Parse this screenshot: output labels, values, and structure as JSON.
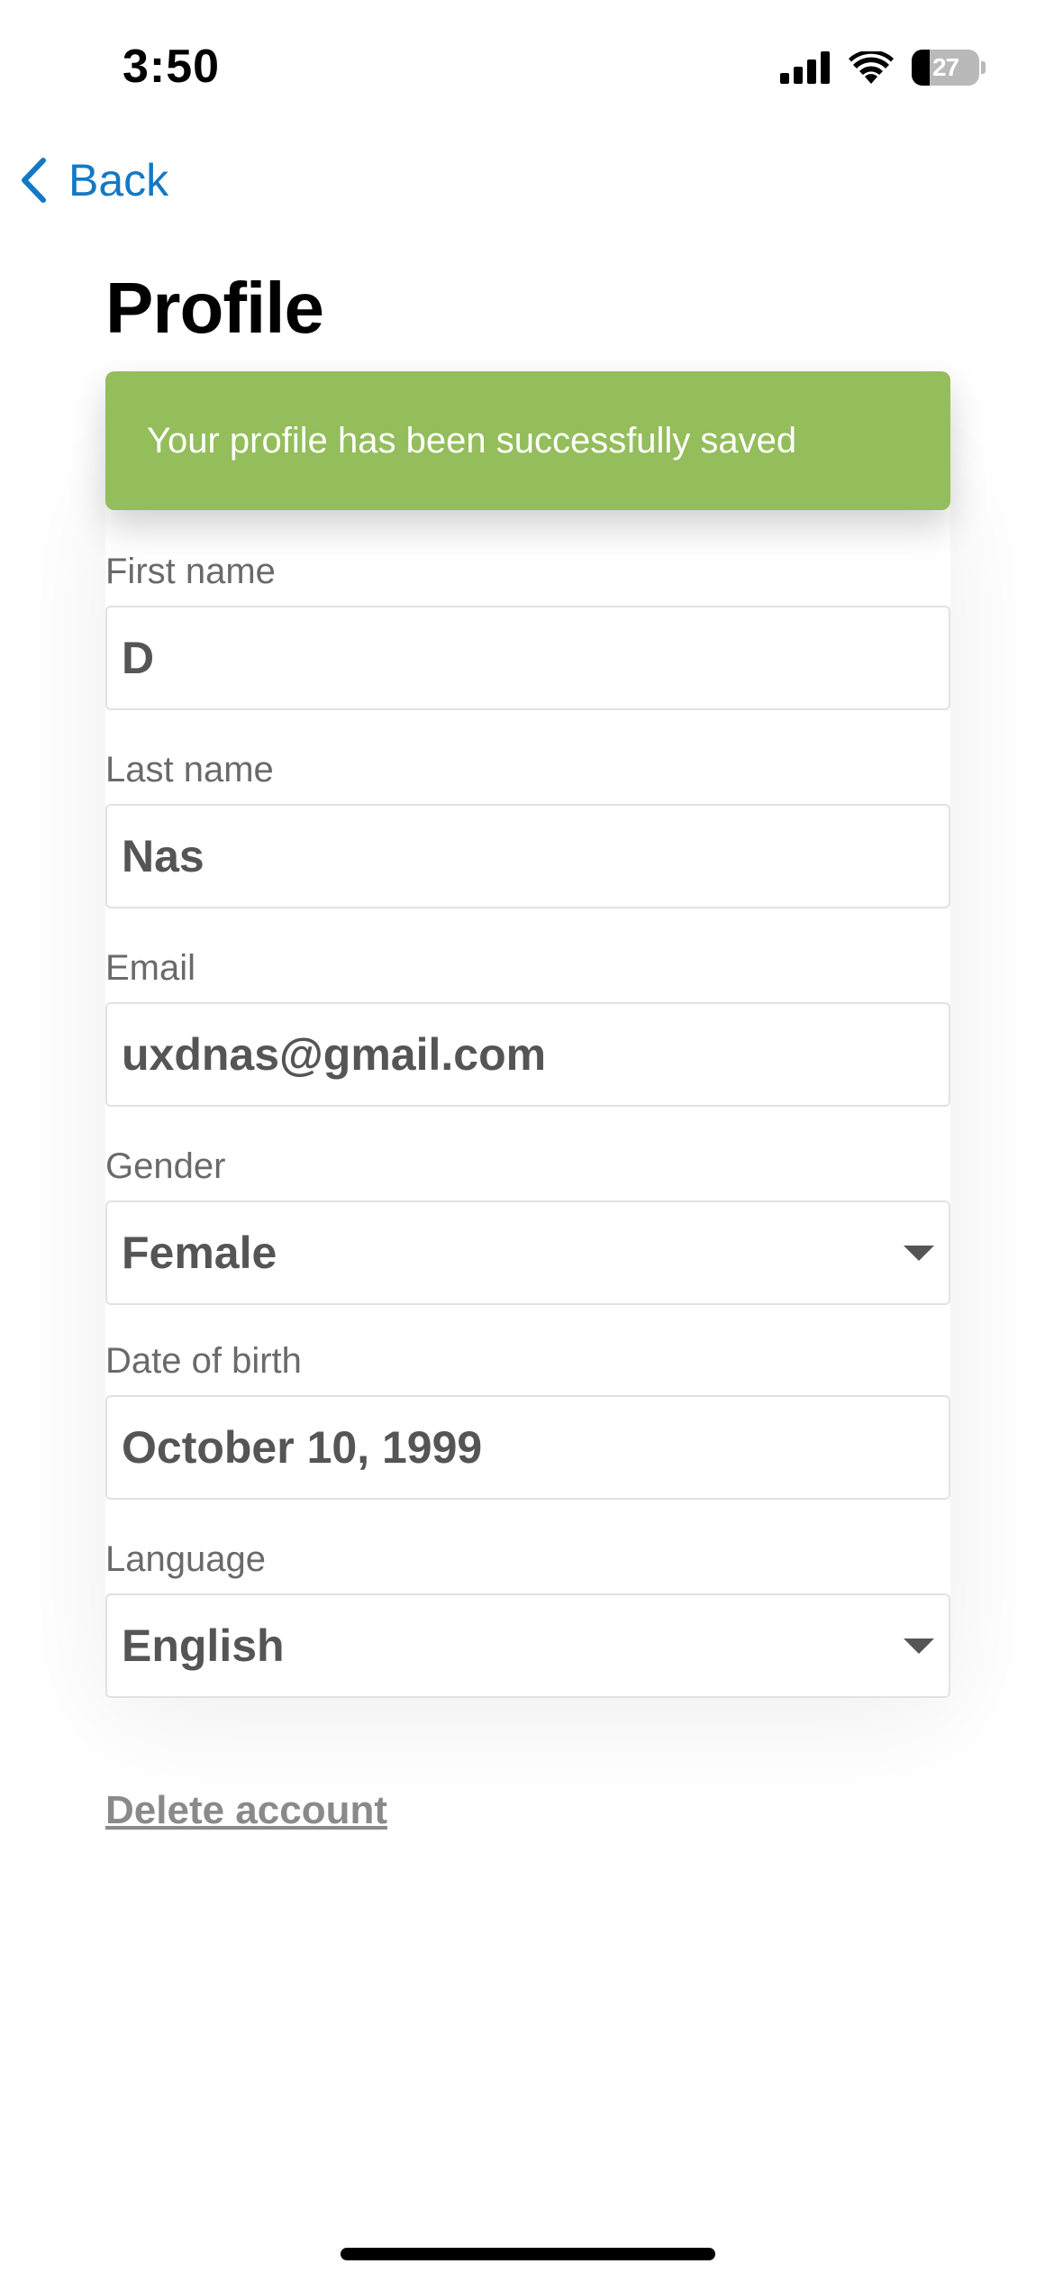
{
  "status_bar": {
    "time": "3:50",
    "battery_level": "27",
    "battery_fraction": 0.27,
    "icons": [
      "signal-icon",
      "wifi-icon",
      "battery-icon"
    ]
  },
  "nav": {
    "back_label": "Back",
    "back_icon": "chevron-left-icon"
  },
  "page": {
    "title": "Profile"
  },
  "toast": {
    "message": "Your profile has been successfully saved",
    "color": "#94bd5b"
  },
  "form": {
    "first_name": {
      "label": "First name",
      "value": "D"
    },
    "last_name": {
      "label": "Last name",
      "value": "Nas"
    },
    "email": {
      "label": "Email",
      "value": "uxdnas@gmail.com"
    },
    "gender": {
      "label": "Gender",
      "value": "Female",
      "icon": "caret-down-icon"
    },
    "date_of_birth": {
      "label": "Date of birth",
      "value": "October 10, 1999"
    },
    "language": {
      "label": "Language",
      "value": "English",
      "icon": "caret-down-icon"
    }
  },
  "actions": {
    "delete_account": "Delete account"
  },
  "colors": {
    "link_blue": "#1479c4",
    "success_green": "#94bd5b",
    "value_gray": "#555555",
    "label_gray": "#6a6a6a"
  }
}
